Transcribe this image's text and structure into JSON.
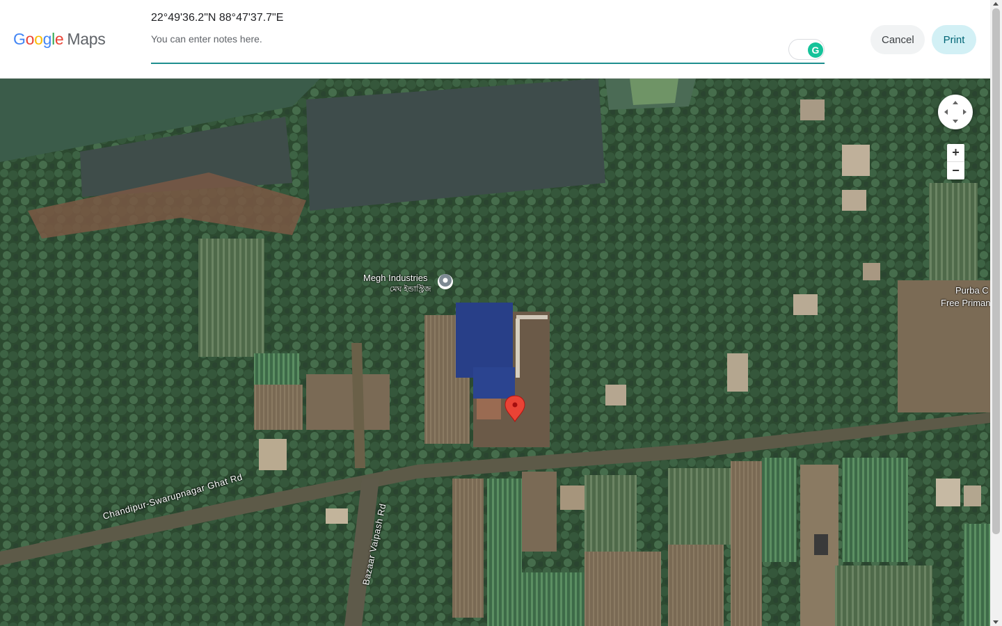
{
  "header": {
    "logo_google": "Google",
    "logo_maps": "Maps",
    "coordinates": "22°49'36.2\"N 88°47'37.7\"E",
    "notes_placeholder": "You can enter notes here.",
    "cancel_label": "Cancel",
    "print_label": "Print"
  },
  "map": {
    "type": "satellite",
    "place_label_en": "Megh Industries",
    "place_label_bn": "মেঘ ইন্ডাস্ট্রিজ",
    "edge_label_line1": "Purba C",
    "edge_label_line2": "Free Priman",
    "road_1": "Chandipur-Swarupnagar Ghat Rd",
    "road_2": "Bazaar Vaipash Rd",
    "zoom_in": "+",
    "zoom_out": "−"
  },
  "colors": {
    "accent_underline": "#1e8e8e",
    "print_bg": "#d2f0f5",
    "print_text": "#006575",
    "pin_red": "#ea4335"
  }
}
